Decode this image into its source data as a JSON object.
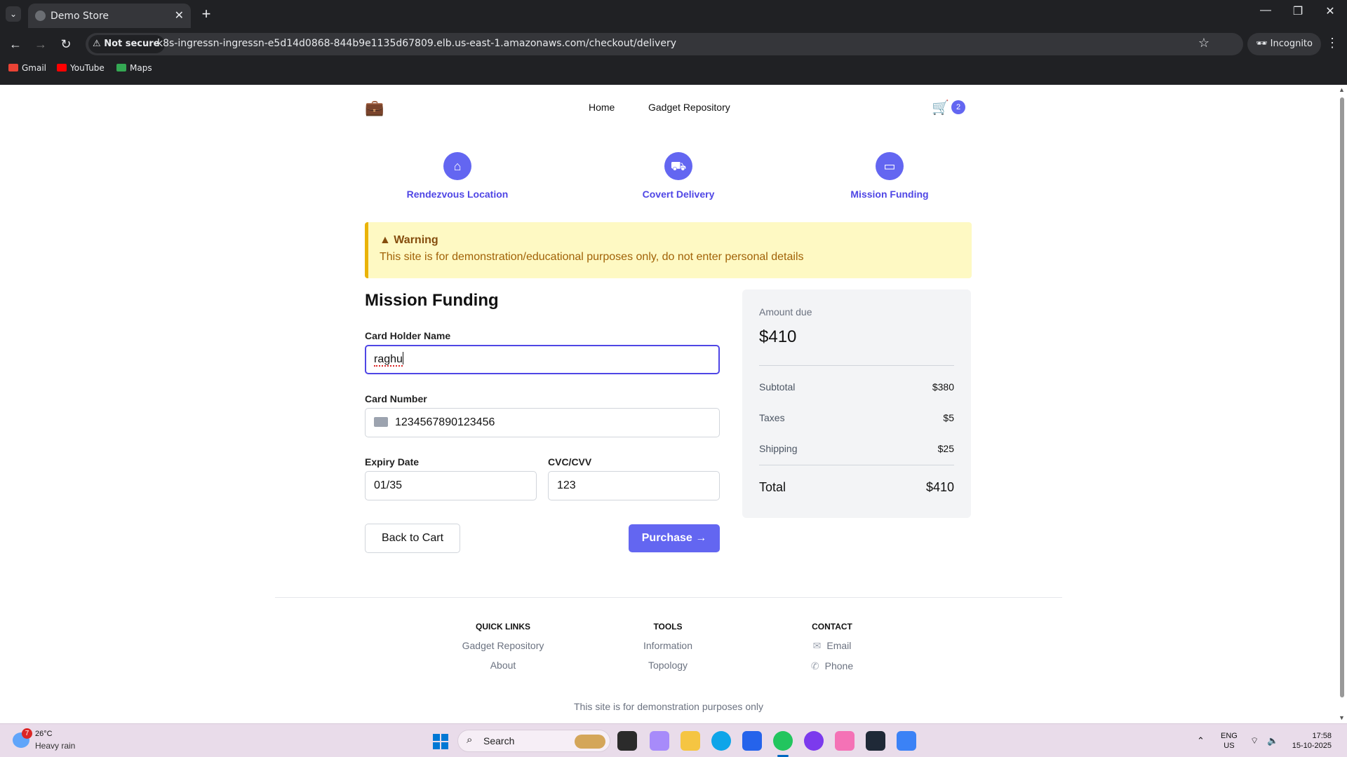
{
  "browser": {
    "tab_title": "Demo Store",
    "not_secure": "Not secure",
    "url": "k8s-ingressn-ingressn-e5d14d0868-844b9e1135d67809.elb.us-east-1.amazonaws.com/checkout/delivery",
    "incognito": "Incognito",
    "bookmarks": [
      "Gmail",
      "YouTube",
      "Maps"
    ]
  },
  "header": {
    "nav": [
      "Home",
      "Gadget Repository"
    ],
    "cart_count": "2"
  },
  "steps": [
    "Rendezvous Location",
    "Covert Delivery",
    "Mission Funding"
  ],
  "warning": {
    "title": "Warning",
    "message": "This site is for demonstration/educational purposes only, do not enter personal details"
  },
  "form": {
    "heading": "Mission Funding",
    "card_holder_label": "Card Holder Name",
    "card_holder_value": "raghu",
    "card_number_label": "Card Number",
    "card_number_value": "1234567890123456",
    "expiry_label": "Expiry Date",
    "expiry_value": "01/35",
    "cvc_label": "CVC/CVV",
    "cvc_value": "123",
    "back_label": "Back to Cart",
    "purchase_label": "Purchase"
  },
  "summary": {
    "due_label": "Amount due",
    "due_value": "$410",
    "rows": [
      {
        "label": "Subtotal",
        "value": "$380"
      },
      {
        "label": "Taxes",
        "value": "$5"
      },
      {
        "label": "Shipping",
        "value": "$25"
      }
    ],
    "total_label": "Total",
    "total_value": "$410"
  },
  "footer": {
    "columns": [
      {
        "heading": "QUICK LINKS",
        "links": [
          "Gadget Repository",
          "About"
        ]
      },
      {
        "heading": "TOOLS",
        "links": [
          "Information",
          "Topology"
        ]
      },
      {
        "heading": "CONTACT",
        "links": [
          "Email",
          "Phone"
        ]
      }
    ],
    "note": "This site is for demonstration purposes only"
  },
  "taskbar": {
    "weather_badge": "7",
    "temperature": "26°C",
    "weather": "Heavy rain",
    "search": "Search",
    "lang1": "ENG",
    "lang2": "US",
    "time": "17:58",
    "date": "15-10-2025"
  },
  "colors": {
    "accent": "#6366f1",
    "warning_bg": "#fef9c3",
    "warning_border": "#eab308"
  }
}
